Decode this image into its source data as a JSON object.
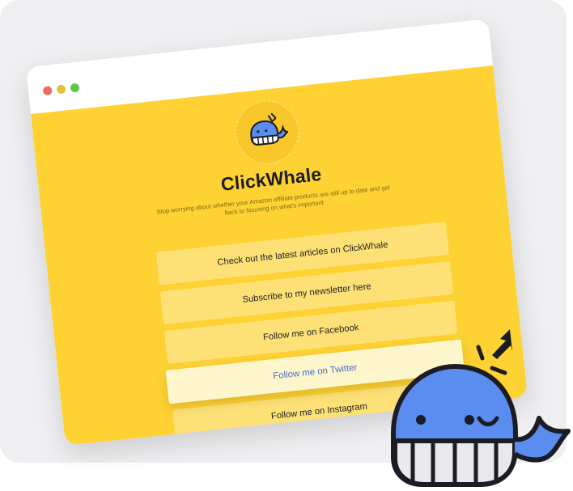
{
  "app": {
    "name": "ClickWhale",
    "tagline": "Stop worrying about whether your Amazon affiliate products are still up to date and get back to focusing on what's important"
  },
  "window_controls": [
    "close",
    "minimize",
    "maximize"
  ],
  "links": [
    {
      "label": "Check out the latest articles on ClickWhale",
      "active": false
    },
    {
      "label": "Subscribe to my newsletter here",
      "active": false
    },
    {
      "label": "Follow me on Facebook",
      "active": false
    },
    {
      "label": "Follow me on Twitter",
      "active": true
    },
    {
      "label": "Follow me on Instagram",
      "active": false
    }
  ],
  "colors": {
    "background": "#efeff1",
    "page_yellow": "#fed232",
    "link_bg": "#fee176",
    "link_active_bg": "#fdf6cd",
    "link_active_text": "#4a6fc9",
    "whale_blue": "#5b8cf0"
  },
  "icons": [
    "whale-logo-icon",
    "whale-mascot-icon",
    "cursor-arrow-icon"
  ]
}
